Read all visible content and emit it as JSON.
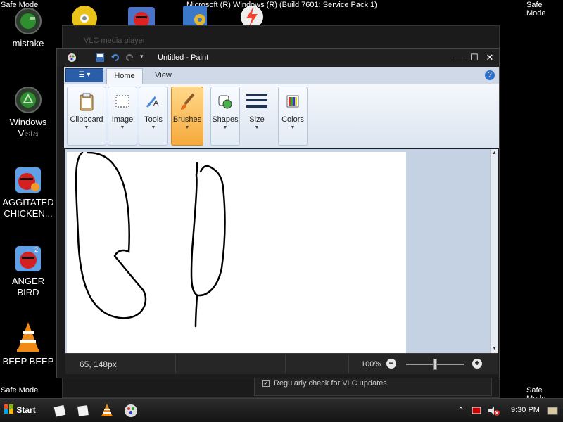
{
  "desktop": {
    "safe_mode": "Safe Mode",
    "build": "Microsoft (R) Windows (R) (Build 7601: Service Pack 1)",
    "icons": [
      {
        "label": "mistake",
        "icon": "green-orb-icon"
      },
      {
        "label": "Windows Vista",
        "icon": "recycle-icon"
      },
      {
        "label": "AGGITATED CHICKEN...",
        "icon": "angry-bird-icon"
      },
      {
        "label": "ANGER BIRD",
        "icon": "angry-bird-icon"
      },
      {
        "label": "BEEP BEEP",
        "icon": "vlc-cone-icon"
      }
    ]
  },
  "vlc": {
    "title": "VLC media player",
    "update_check": "Regularly check for VLC updates",
    "update_checked": true
  },
  "paint": {
    "title": "Untitled - Paint",
    "tabs": [
      "Home",
      "View"
    ],
    "active_tab": "Home",
    "groups": [
      "Clipboard",
      "Image",
      "Tools",
      "Brushes",
      "Shapes",
      "Size",
      "Colors"
    ],
    "active_group": "Brushes",
    "status": {
      "coords": "65, 148px",
      "zoom": "100%",
      "zoom_level": 1.0
    }
  },
  "taskbar": {
    "start_label": "Start",
    "clock": "9:30 PM"
  },
  "colors": {
    "ribbon_blue": "#2a5ea8",
    "active_group": "#f6a93b",
    "canvas_bg": "#c5d2e3"
  }
}
